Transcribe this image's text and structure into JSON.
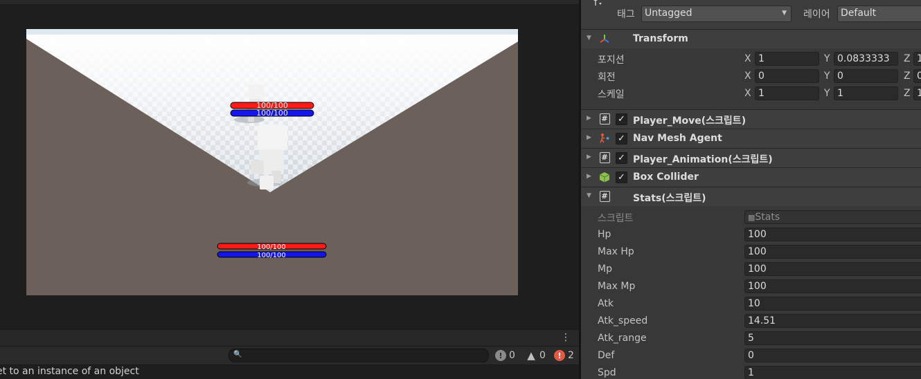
{
  "game": {
    "enemy_hp": "100/100",
    "enemy_mp": "100/100",
    "player_hp": "100/100",
    "player_mp": "100/100",
    "colors": {
      "hp": "#ff1a1a",
      "mp": "#1414ee",
      "ground": "#6b605a",
      "sky": "#dfe9f1"
    }
  },
  "console": {
    "menu_icon": "kebab-menu-icon",
    "log_count": "0",
    "warning_count": "0",
    "error_count": "2",
    "message": "et to an instance of an object"
  },
  "inspector": {
    "tag_label": "태그",
    "tag_value": "Untagged",
    "layer_label": "레이어",
    "layer_value": "Default",
    "transform": {
      "title": "Transform",
      "position_label": "포지션",
      "rotation_label": "회전",
      "scale_label": "스케일",
      "axis_x": "X",
      "axis_y": "Y",
      "axis_z": "Z",
      "position": {
        "x": "1",
        "y": "0.0833333",
        "z": "1"
      },
      "rotation": {
        "x": "0",
        "y": "0",
        "z": "0"
      },
      "scale": {
        "x": "1",
        "y": "1",
        "z": "1"
      }
    },
    "components": [
      {
        "title": "Player_Move(스크립트)",
        "icon": "script-icon"
      },
      {
        "title": "Nav Mesh Agent",
        "icon": "nav-mesh-agent-icon"
      },
      {
        "title": "Player_Animation(스크립트)",
        "icon": "script-icon"
      },
      {
        "title": "Box Collider",
        "icon": "box-collider-icon"
      }
    ],
    "stats": {
      "title": "Stats(스크립트)",
      "script_label": "스크립트",
      "script_value": "Stats",
      "hp_label": "Hp",
      "hp": "100",
      "max_hp_label": "Max Hp",
      "max_hp": "100",
      "mp_label": "Mp",
      "mp": "100",
      "max_mp_label": "Max Mp",
      "max_mp": "100",
      "atk_label": "Atk",
      "atk": "10",
      "atk_speed_label": "Atk_speed",
      "atk_speed": "14.51",
      "atk_range_label": "Atk_range",
      "atk_range": "5",
      "def_label": "Def",
      "def": "0",
      "spd_label": "Spd",
      "spd": "1"
    }
  }
}
